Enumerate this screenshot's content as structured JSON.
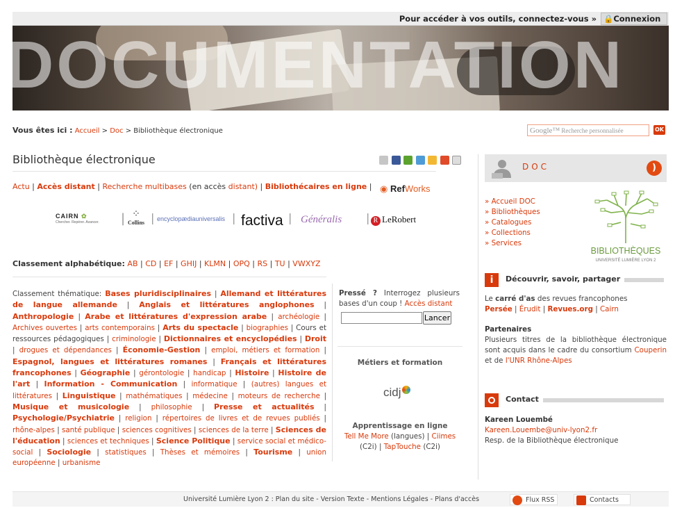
{
  "topbar": {
    "login_prompt": "Pour accéder à vos outils, connectez-vous »",
    "login_button": "Connexion"
  },
  "banner": {
    "word": "DOCUMENTATION"
  },
  "breadcrumb": {
    "label": "Vous êtes ici :",
    "items": [
      "Accueil",
      ">",
      "Doc",
      ">",
      "Bibliothèque électronique"
    ]
  },
  "search": {
    "brand": "Google™",
    "placeholder": "Recherche personnalisée",
    "button": "OK"
  },
  "page_title": "Bibliothèque électronique",
  "share_colors": [
    "#c6c6c6",
    "#3b5998",
    "#5ba32e",
    "#4f9bd6",
    "#f3b833",
    "#e04b2a",
    "#999999"
  ],
  "links_row": {
    "actu": "Actu",
    "acces_distant": "Accès distant",
    "recherche": "Recherche multibases",
    "en_acces": "(en accès",
    "distant": "distant)",
    "bibliothecaires": "Bibliothécaires en ligne",
    "refworks_a": "Ref",
    "refworks_b": "Works"
  },
  "logos": {
    "cairn": "CAIRN",
    "cairn_sub": "Chercher. Repérer. Avancer.",
    "collins": "Collins",
    "encyclopaedia": "encyclopædiauniversalis",
    "factiva": "factiva",
    "generalis": "Généralis",
    "lerobert": "LeRobert"
  },
  "alpha": {
    "label": "Classement alphabétique:",
    "groups": [
      "AB",
      "CD",
      "EF",
      "GHIJ",
      "KLMN",
      "OPQ",
      "RS",
      "TU",
      "VWXYZ"
    ]
  },
  "theme": {
    "label": "Classement thématique:",
    "items": [
      {
        "t": "Bases pluridisciplinaires",
        "b": true
      },
      {
        "t": "Allemand et littératures de langue allemande",
        "b": true
      },
      {
        "t": "Anglais et littératures anglophones",
        "b": true
      },
      {
        "t": "Anthropologie",
        "b": true
      },
      {
        "t": "Arabe et littératures d'expression arabe",
        "b": true
      },
      {
        "t": "archéologie",
        "b": false
      },
      {
        "t": "Archives ouvertes",
        "b": false
      },
      {
        "t": "arts contemporains",
        "b": false
      },
      {
        "t": "Arts du spectacle",
        "b": true
      },
      {
        "t": "biographies",
        "b": false
      },
      {
        "t": "Cours et ressources pédagogiques",
        "b": false,
        "plain": true
      },
      {
        "t": "criminologie",
        "b": false
      },
      {
        "t": "Dictionnaires et encyclopédies",
        "b": true
      },
      {
        "t": "Droit",
        "b": true
      },
      {
        "t": "drogues et dépendances",
        "b": false
      },
      {
        "t": "Économie-Gestion",
        "b": true
      },
      {
        "t": "emploi, métiers et formation",
        "b": false
      },
      {
        "t": "Espagnol, langues et littératures romanes",
        "b": true
      },
      {
        "t": "Français et littératures francophones",
        "b": true
      },
      {
        "t": "Géographie",
        "b": true
      },
      {
        "t": "gérontologie",
        "b": false
      },
      {
        "t": "handicap",
        "b": false
      },
      {
        "t": "Histoire",
        "b": true
      },
      {
        "t": "Histoire de l'art",
        "b": true
      },
      {
        "t": "Information - Communication",
        "b": true
      },
      {
        "t": "informatique",
        "b": false
      },
      {
        "t": "(autres) langues et littératures",
        "b": false
      },
      {
        "t": "Linguistique",
        "b": true
      },
      {
        "t": "mathématiques",
        "b": false
      },
      {
        "t": "médecine",
        "b": false
      },
      {
        "t": "moteurs de recherche",
        "b": false
      },
      {
        "t": "Musique et musicologie",
        "b": true
      },
      {
        "t": "philosophie",
        "b": false
      },
      {
        "t": "Presse et actualités",
        "b": true
      },
      {
        "t": "Psychologie/Psychiatrie",
        "b": true
      },
      {
        "t": "religion",
        "b": false
      },
      {
        "t": "répertoires de livres et de revues publiés",
        "b": false
      },
      {
        "t": "rhône-alpes",
        "b": false
      },
      {
        "t": "santé publique",
        "b": false
      },
      {
        "t": "sciences cognitives",
        "b": false
      },
      {
        "t": "sciences de la terre",
        "b": false
      },
      {
        "t": "Sciences de l'éducation",
        "b": true
      },
      {
        "t": "sciences et techniques",
        "b": false
      },
      {
        "t": "Science Politique",
        "b": true
      },
      {
        "t": "service social et médico-social",
        "b": false
      },
      {
        "t": "Sociologie",
        "b": true
      },
      {
        "t": "statistiques",
        "b": false
      },
      {
        "t": "Thèses et mémoires",
        "b": false
      },
      {
        "t": "Tourisme",
        "b": true
      },
      {
        "t": "union européenne",
        "b": false
      },
      {
        "t": "urbanisme",
        "b": false
      }
    ]
  },
  "presse": {
    "label": "Pressé ?",
    "text": "Interrogez plusieurs bases d'un coup !",
    "link": "Accès distant",
    "button": "Lancer"
  },
  "metiers": {
    "title": "Métiers et formation",
    "logo": "cidj"
  },
  "apprentissage": {
    "title": "Apprentissage en ligne",
    "l1": "Tell Me More",
    "t1": "(langues) |",
    "l2": "Ciimes",
    "t2": "(C2i) |",
    "l3": "TapTouche",
    "t3": "(C2i)"
  },
  "right": {
    "doc_title": "DOC",
    "nav": [
      "Accueil DOC",
      "Bibliothèques",
      "Catalogues",
      "Collections",
      "Services"
    ],
    "nav_prefix": "»",
    "bib_title": "BIBLIOTHÈQUES",
    "bib_sub": "UNIVERSITÉ LUMIÈRE LYON 2",
    "decouvrir_title": "Découvrir, savoir, partager",
    "decouvrir_text_a": "Le",
    "decouvrir_text_b": "carré d'as",
    "decouvrir_text_c": "des revues francophones",
    "revues": [
      "Persée",
      "Érudit",
      "Revues.org",
      "Cairn"
    ],
    "partenaires_title": "Partenaires",
    "partenaires_text": "Plusieurs titres de la bibliothèque électronique sont acquis dans le cadre du consortium",
    "couperin": "Couperin",
    "et_de": "et de",
    "unr": "l'UNR Rhône-Alpes",
    "contact_title": "Contact",
    "contact_name": "Kareen Louembé",
    "contact_email": "Kareen.Louembe@univ-lyon2.fr",
    "contact_role": "Resp. de la Bibliothèque électronique"
  },
  "footer": {
    "text": "Université Lumière Lyon 2 : Plan du site  - Version Texte  - Mentions Légales  - Plans d'accès",
    "rss": "Flux RSS",
    "contacts": "Contacts"
  }
}
